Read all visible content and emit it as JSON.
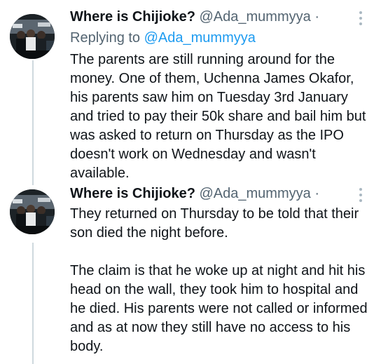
{
  "tweets": [
    {
      "author": {
        "display_name": "Where is Chijioke?",
        "handle": "@Ada_mummyya",
        "separator": "·",
        "avatar_icon": "profile-photo-icon"
      },
      "replying_to": {
        "prefix": "Replying to",
        "handle": "@Ada_mummyya"
      },
      "text": "The parents are still running around for the money. One of them, Uchenna James Okafor, his parents saw him on Tuesday 3rd January and tried to pay their 50k share and bail him but was asked to return on Thursday as the IPO doesn't work on Wednesday and wasn't available."
    },
    {
      "author": {
        "display_name": "Where is Chijioke?",
        "handle": "@Ada_mummyya",
        "separator": "·",
        "avatar_icon": "profile-photo-icon"
      },
      "text": "They returned on Thursday to be told that their son died the night before.\n\nThe claim is that he woke up at night and hit his head on the wall, they took him to hospital and he died. His parents were not called or informed and as at now they still have no access to his body."
    }
  ],
  "colors": {
    "text": "#0f1419",
    "secondary": "#536471",
    "link": "#1d9bf0",
    "thread_line": "#cfd9de"
  }
}
